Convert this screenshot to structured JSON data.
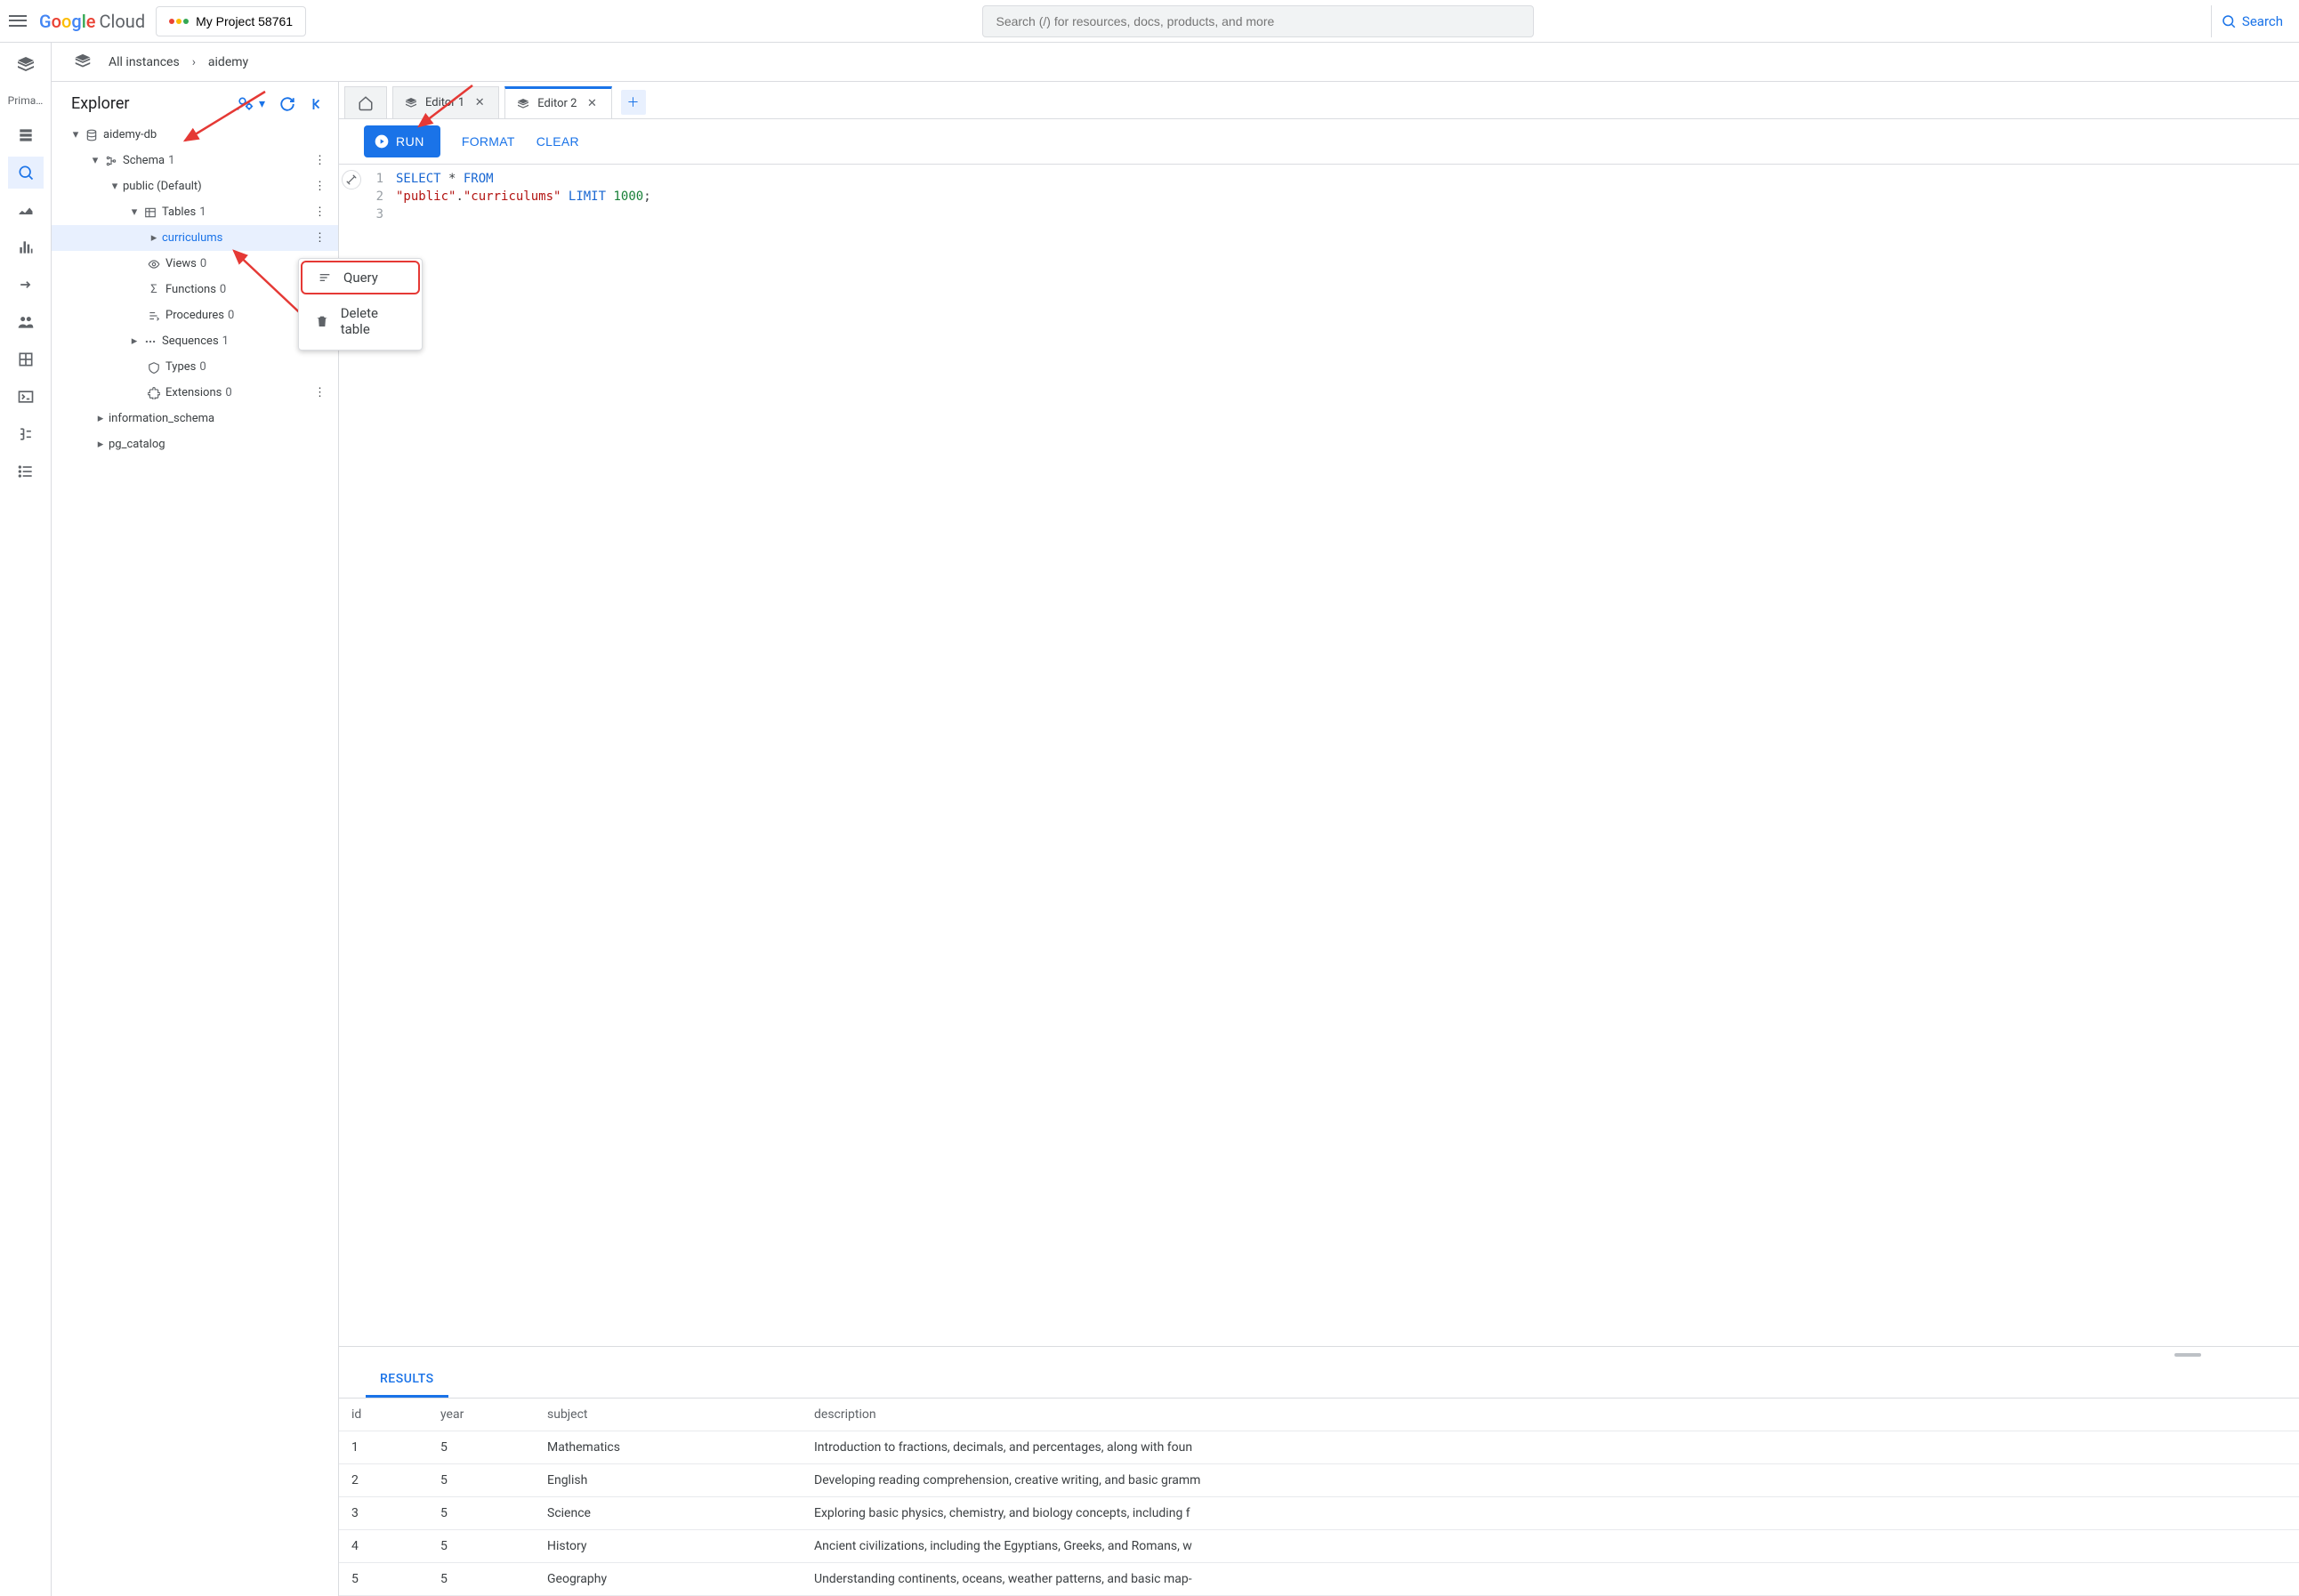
{
  "header": {
    "brand_cloud": "Cloud",
    "project_button": "My Project 58761",
    "search_placeholder": "Search (/) for resources, docs, products, and more",
    "search_button": "Search"
  },
  "rail": {
    "label": "Prima…"
  },
  "breadcrumb": {
    "all": "All instances",
    "current": "aidemy"
  },
  "explorer": {
    "title": "Explorer",
    "db": "aidemy-db",
    "schema_label": "Schema",
    "schema_count": "1",
    "public": "public (Default)",
    "tables_label": "Tables",
    "tables_count": "1",
    "table_curriculums": "curriculums",
    "views_label": "Views",
    "views_count": "0",
    "functions_label": "Functions",
    "functions_count": "0",
    "procedures_label": "Procedures",
    "procedures_count": "0",
    "sequences_label": "Sequences",
    "sequences_count": "1",
    "types_label": "Types",
    "types_count": "0",
    "extensions_label": "Extensions",
    "extensions_count": "0",
    "info_schema": "information_schema",
    "pg_catalog": "pg_catalog"
  },
  "context_menu": {
    "query": "Query",
    "delete": "Delete table"
  },
  "tabs": {
    "editor1": "Editor 1",
    "editor2": "Editor 2"
  },
  "toolbar": {
    "run": "RUN",
    "format": "FORMAT",
    "clear": "CLEAR"
  },
  "sql": {
    "l1a": "SELECT",
    "l1b": " * ",
    "l1c": "FROM",
    "l2a": "  ",
    "l2b": "\"public\"",
    "l2c": ".",
    "l2d": "\"curriculums\"",
    "l2e": " ",
    "l2f": "LIMIT",
    "l2g": " ",
    "l2h": "1000",
    "l2i": ";"
  },
  "results": {
    "tab": "RESULTS",
    "columns": [
      "id",
      "year",
      "subject",
      "description"
    ],
    "rows": [
      {
        "id": "1",
        "year": "5",
        "subject": "Mathematics",
        "description": "Introduction to fractions, decimals, and percentages, along with foun"
      },
      {
        "id": "2",
        "year": "5",
        "subject": "English",
        "description": "Developing reading comprehension, creative writing, and basic gramm"
      },
      {
        "id": "3",
        "year": "5",
        "subject": "Science",
        "description": "Exploring basic physics, chemistry, and biology concepts, including f"
      },
      {
        "id": "4",
        "year": "5",
        "subject": "History",
        "description": "Ancient civilizations, including the Egyptians, Greeks, and Romans, w"
      },
      {
        "id": "5",
        "year": "5",
        "subject": "Geography",
        "description": "Understanding continents, oceans, weather patterns, and basic map-"
      }
    ]
  }
}
